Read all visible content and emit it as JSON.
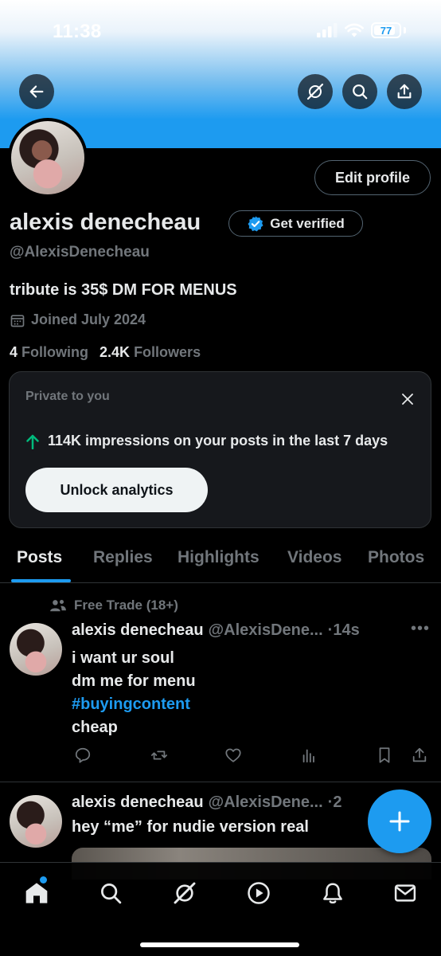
{
  "status_bar": {
    "time": "11:38",
    "battery": "77"
  },
  "header": {
    "buttons": [
      {
        "icon": "back-arrow-icon"
      },
      {
        "icon": "grok-icon"
      },
      {
        "icon": "search-icon"
      },
      {
        "icon": "share-icon"
      }
    ]
  },
  "profile": {
    "edit_profile_label": "Edit profile",
    "display_name": "alexis denecheau",
    "get_verified_label": "Get verified",
    "handle": "@AlexisDenecheau",
    "bio": "tribute is 35$ DM FOR MENUS",
    "joined": "Joined July 2024",
    "following_count": "4",
    "following_label": "Following",
    "followers_count": "2.4K",
    "followers_label": "Followers"
  },
  "analytics_card": {
    "private_label": "Private to you",
    "impressions_text": "114K impressions on your posts in the last 7 days",
    "unlock_label": "Unlock analytics"
  },
  "tabs": [
    {
      "label": "Posts",
      "active": true
    },
    {
      "label": "Replies"
    },
    {
      "label": "Highlights"
    },
    {
      "label": "Videos"
    },
    {
      "label": "Photos"
    }
  ],
  "posts": [
    {
      "community": "Free Trade (18+)",
      "name": "alexis denecheau",
      "handle": "@AlexisDene...",
      "time": "·14s",
      "lines": [
        "i want ur soul",
        "dm me for menu",
        "#buyingcontent",
        "cheap"
      ]
    },
    {
      "name": "alexis denecheau",
      "handle": "@AlexisDene...",
      "time": "·2",
      "lines": [
        "hey “me” for nudie version real"
      ]
    }
  ],
  "colors": {
    "accent": "#1d9bf0",
    "background": "#000000",
    "secondary_text": "#71767b",
    "border": "#2f3336",
    "analytics_arrow": "#00ba7c"
  },
  "bottom_nav": [
    {
      "icon": "home-icon",
      "active": true,
      "has_badge": true
    },
    {
      "icon": "search-icon"
    },
    {
      "icon": "grok-icon"
    },
    {
      "icon": "video-play-icon"
    },
    {
      "icon": "notifications-bell-icon"
    },
    {
      "icon": "messages-envelope-icon"
    }
  ]
}
